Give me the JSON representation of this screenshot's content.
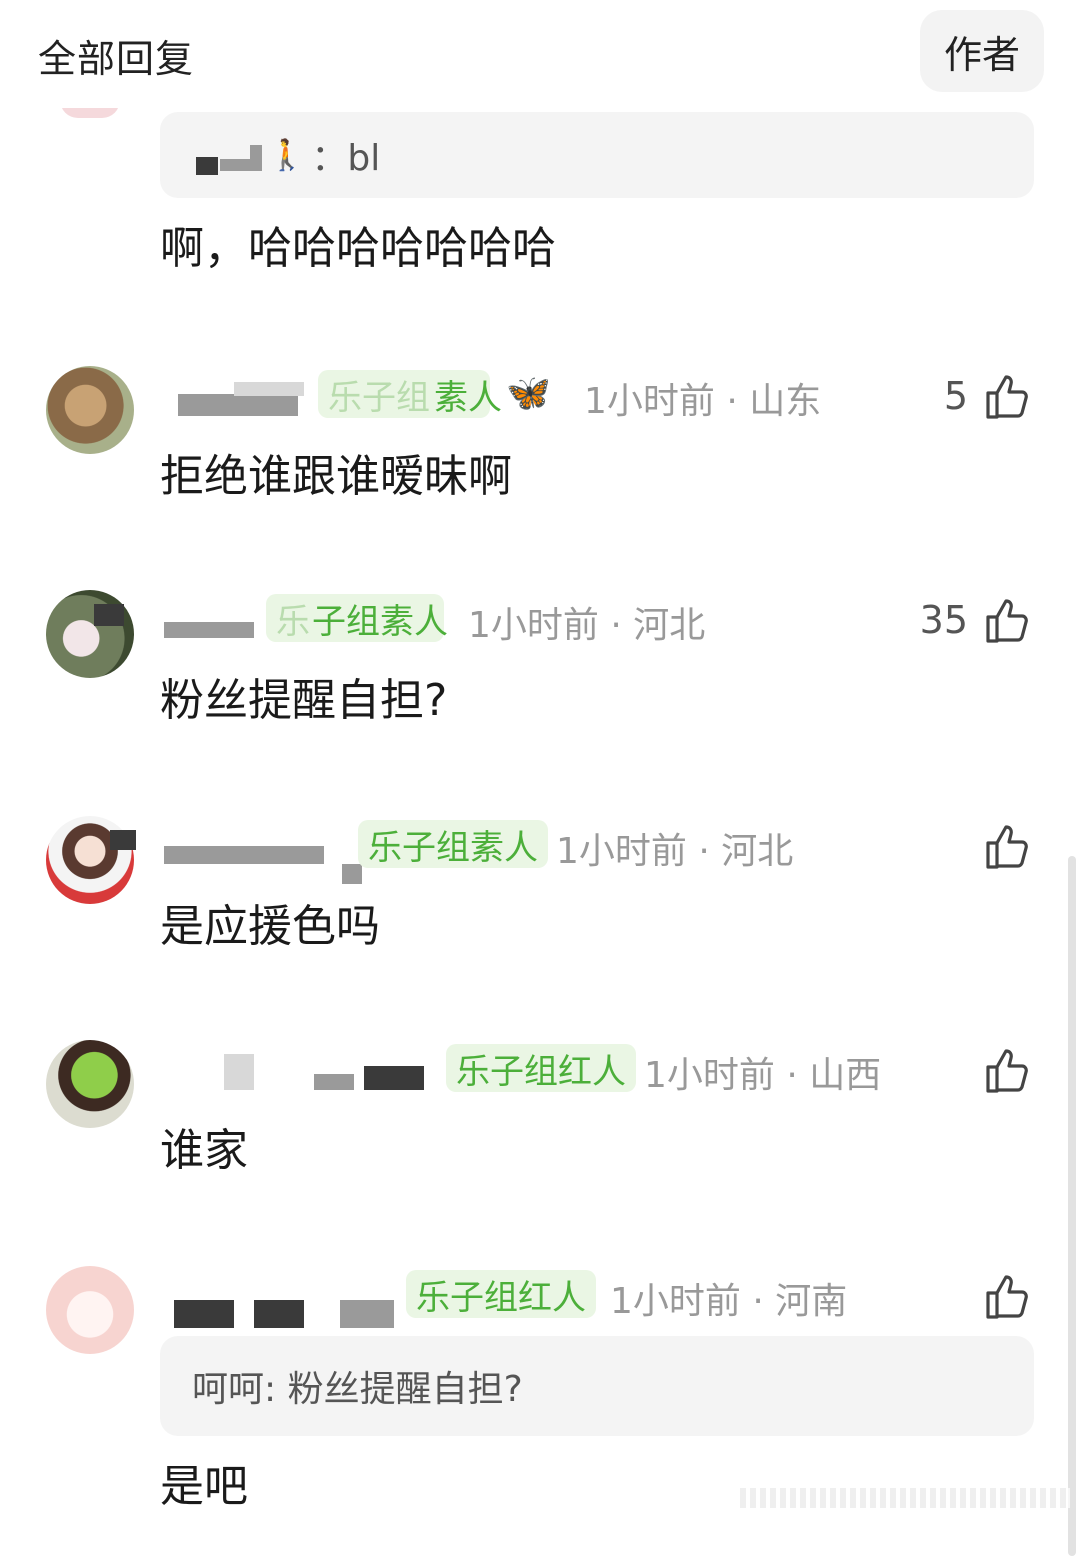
{
  "header": {
    "title": "全部回复",
    "author_button": "作者"
  },
  "top_reply": {
    "quote": "：bl",
    "text": "啊，哈哈哈哈哈哈哈"
  },
  "comments": [
    {
      "badge": "素人",
      "emoji": "🦋",
      "time": "1小时前",
      "location": "山东",
      "likes": "5",
      "text": "拒绝谁跟谁暧昧啊"
    },
    {
      "badge": "子组素人",
      "time": "1小时前",
      "location": "河北",
      "likes": "35",
      "text": "粉丝提醒自担?"
    },
    {
      "badge": "乐子组素人",
      "time": "1小时前",
      "location": "河北",
      "likes": "",
      "text": "是应援色吗"
    },
    {
      "badge": "乐子组红人",
      "time": "1小时前",
      "location": "山西",
      "likes": "",
      "text": "谁家"
    },
    {
      "badge": "乐子组红人",
      "time": "1小时前",
      "location": "河南",
      "likes": "",
      "quote": "呵呵: 粉丝提醒自担?",
      "text": "是吧"
    }
  ],
  "colors": {
    "badge_bg": "#eaf6e4",
    "badge_text": "#4caf3a",
    "meta": "#999999",
    "quote_bg": "#f4f4f4"
  },
  "icons": [
    "thumb-up-icon",
    "butterfly-icon",
    "walking-person-icon"
  ]
}
